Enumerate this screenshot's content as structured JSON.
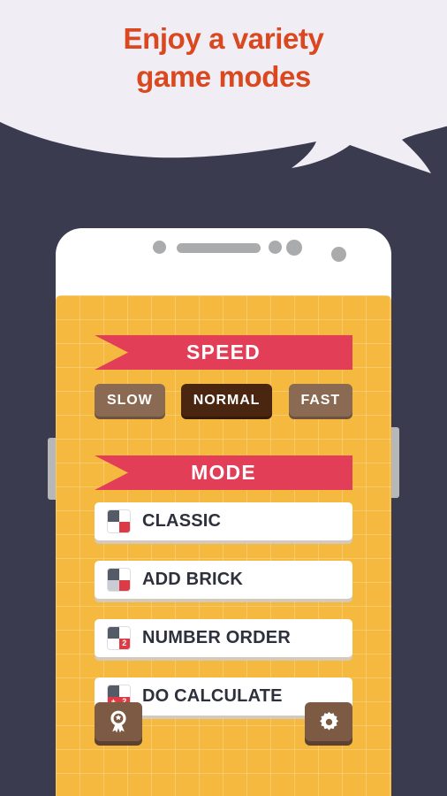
{
  "promo": {
    "headline_line1": "Enjoy a variety",
    "headline_line2": "game modes",
    "text_color": "#D9481F",
    "bubble_color": "#F0EDF4",
    "background_color": "#3B3B4F"
  },
  "phone": {
    "frame_color": "#FFFFFF",
    "speaker_color": "#AAABAD",
    "side_button_color": "#B6B7B9",
    "screen_background": "#F6B93F"
  },
  "screen": {
    "speed_section": {
      "banner_label": "SPEED",
      "banner_color": "#E23E57",
      "options": [
        {
          "label": "SLOW",
          "selected": false
        },
        {
          "label": "NORMAL",
          "selected": true
        },
        {
          "label": "FAST",
          "selected": false
        }
      ],
      "unselected_color": "#8B6A53",
      "selected_color": "#4A2611"
    },
    "mode_section": {
      "banner_label": "MODE",
      "banner_color": "#E23E57",
      "options": [
        {
          "label": "CLASSIC",
          "icon": "grid-classic-icon",
          "cells": [
            {
              "fill": "dark",
              "text": ""
            },
            {
              "fill": "white",
              "text": ""
            },
            {
              "fill": "white",
              "text": ""
            },
            {
              "fill": "red",
              "text": ""
            }
          ]
        },
        {
          "label": "ADD BRICK",
          "icon": "grid-add-brick-icon",
          "cells": [
            {
              "fill": "dark",
              "text": ""
            },
            {
              "fill": "white",
              "text": ""
            },
            {
              "fill": "gray",
              "text": ""
            },
            {
              "fill": "red",
              "text": ""
            }
          ]
        },
        {
          "label": "NUMBER ORDER",
          "icon": "grid-number-order-icon",
          "cells": [
            {
              "fill": "dark",
              "text": ""
            },
            {
              "fill": "white",
              "text": ""
            },
            {
              "fill": "white",
              "text": ""
            },
            {
              "fill": "red",
              "text": "2"
            }
          ]
        },
        {
          "label": "DO CALCULATE",
          "icon": "grid-do-calculate-icon",
          "cells": [
            {
              "fill": "dark",
              "text": ""
            },
            {
              "fill": "white",
              "text": ""
            },
            {
              "fill": "red",
              "text": "+"
            },
            {
              "fill": "red",
              "text": "2"
            }
          ]
        }
      ]
    },
    "bottom_bar": {
      "buttons": [
        {
          "name": "achievements",
          "icon": "award-ribbon-icon"
        },
        {
          "name": "settings",
          "icon": "gear-icon"
        }
      ],
      "button_color": "#7D5A44"
    }
  }
}
